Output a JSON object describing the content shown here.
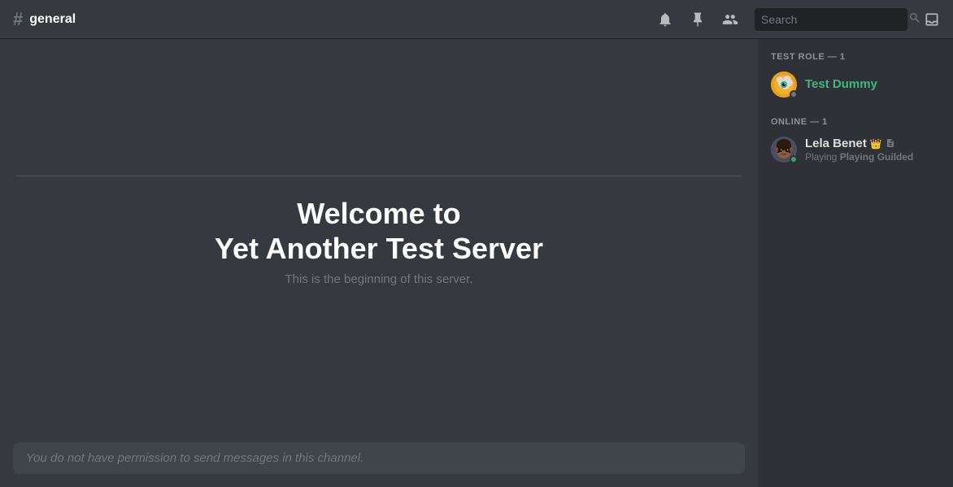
{
  "header": {
    "channel_icon": "#",
    "channel_name": "general",
    "icons": [
      {
        "name": "bell-icon",
        "symbol": "🔔"
      },
      {
        "name": "pin-icon",
        "symbol": "📌"
      },
      {
        "name": "members-icon",
        "symbol": "👥"
      }
    ],
    "search_placeholder": "Search",
    "inbox_icon": "☐"
  },
  "chat": {
    "welcome_title_line1": "Welcome to",
    "welcome_title_line2": "Yet Another Test Server",
    "welcome_subtitle": "This is the beginning of this server.",
    "message_input_placeholder": "You do not have permission to send messages in this channel."
  },
  "members_sidebar": {
    "groups": [
      {
        "label": "TEST ROLE — 1",
        "members": [
          {
            "id": "test-dummy",
            "name": "Test Dummy",
            "status": "offline",
            "avatar_type": "robot",
            "name_color": "green",
            "crown": false,
            "note": false,
            "status_text": null
          }
        ]
      },
      {
        "label": "ONLINE — 1",
        "members": [
          {
            "id": "lela-benet",
            "name": "Lela Benet",
            "status": "online",
            "avatar_type": "lela",
            "name_color": "default",
            "crown": true,
            "note": true,
            "status_text": "Playing Guilded"
          }
        ]
      }
    ]
  }
}
